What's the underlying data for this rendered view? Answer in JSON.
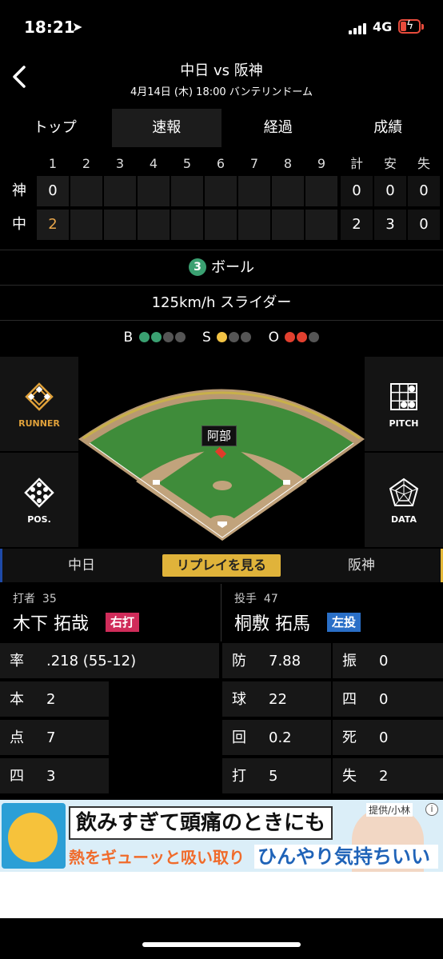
{
  "status_bar": {
    "time": "18:21",
    "network": "4G"
  },
  "header": {
    "title": "中日 vs 阪神",
    "subtitle": "4月14日 (木) 18:00 バンテリンドーム"
  },
  "tabs": [
    {
      "label": "トップ"
    },
    {
      "label": "速報"
    },
    {
      "label": "経過"
    },
    {
      "label": "成績"
    }
  ],
  "scoreboard": {
    "headers": [
      "1",
      "2",
      "3",
      "4",
      "5",
      "6",
      "7",
      "8",
      "9",
      "計",
      "安",
      "失"
    ],
    "teams": [
      {
        "name": "神",
        "innings": [
          "0",
          "",
          "",
          "",
          "",
          "",
          "",
          "",
          ""
        ],
        "totals": [
          "0",
          "0",
          "0"
        ]
      },
      {
        "name": "中",
        "innings": [
          "2",
          "",
          "",
          "",
          "",
          "",
          "",
          "",
          ""
        ],
        "totals": [
          "2",
          "3",
          "0"
        ]
      }
    ]
  },
  "pitch": {
    "result_number": "3",
    "result_label": "ボール",
    "detail": "125km/h スライダー"
  },
  "count": {
    "b_label": "B",
    "s_label": "S",
    "o_label": "O",
    "balls": 2,
    "strikes": 1,
    "outs": 2,
    "ball_color": "#3aa071",
    "strike_color": "#f2c344",
    "out_color": "#e2402f"
  },
  "side_buttons": {
    "runner": "RUNNER",
    "pitch": "PITCH",
    "pos": "POS.",
    "data": "DATA"
  },
  "field": {
    "fielder": "阿部"
  },
  "team_bar": {
    "home": "中日",
    "replay": "リプレイを見る",
    "away": "阪神"
  },
  "batter": {
    "role": "打者",
    "number": "35",
    "name": "木下 拓哉",
    "hand": "右打",
    "stats": [
      {
        "k": "率",
        "v": ".218 (55-12)"
      },
      {
        "k": "本",
        "v": "2"
      },
      {
        "k": "点",
        "v": "7"
      },
      {
        "k": "四",
        "v": "3"
      }
    ]
  },
  "pitcher": {
    "role": "投手",
    "number": "47",
    "name": "桐敷 拓馬",
    "hand": "左投",
    "stats_left": [
      {
        "k": "防",
        "v": "7.88"
      },
      {
        "k": "球",
        "v": "22"
      },
      {
        "k": "回",
        "v": "0.2"
      },
      {
        "k": "打",
        "v": "5"
      }
    ],
    "stats_right": [
      {
        "k": "振",
        "v": "0"
      },
      {
        "k": "四",
        "v": "0"
      },
      {
        "k": "死",
        "v": "0"
      },
      {
        "k": "失",
        "v": "2"
      }
    ]
  },
  "ad": {
    "headline": "飲みすぎて頭痛のときにも",
    "line_red": "熱をギューッと吸い取り",
    "line_blue": "ひんやり気持ちいい",
    "badge": "提供/小林"
  }
}
